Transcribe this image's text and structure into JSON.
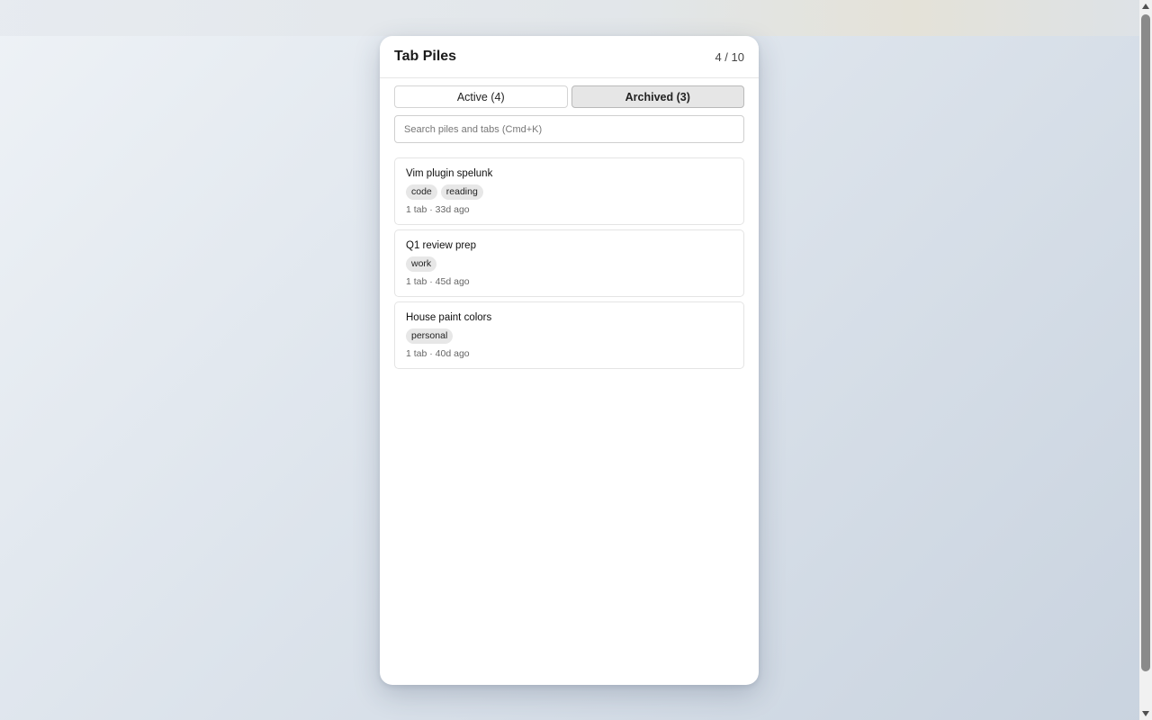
{
  "header": {
    "title": "Tab Piles",
    "counter": "4 / 10"
  },
  "tabs": [
    {
      "label": "Active (4)",
      "selected": false
    },
    {
      "label": "Archived (3)",
      "selected": true
    }
  ],
  "search": {
    "placeholder": "Search piles and tabs (Cmd+K)",
    "value": ""
  },
  "piles": [
    {
      "name": "Vim plugin spelunk",
      "tags": [
        "code",
        "reading"
      ],
      "meta": "1 tab · 33d ago"
    },
    {
      "name": "Q1 review prep",
      "tags": [
        "work"
      ],
      "meta": "1 tab · 45d ago"
    },
    {
      "name": "House paint colors",
      "tags": [
        "personal"
      ],
      "meta": "1 tab · 40d ago"
    }
  ]
}
